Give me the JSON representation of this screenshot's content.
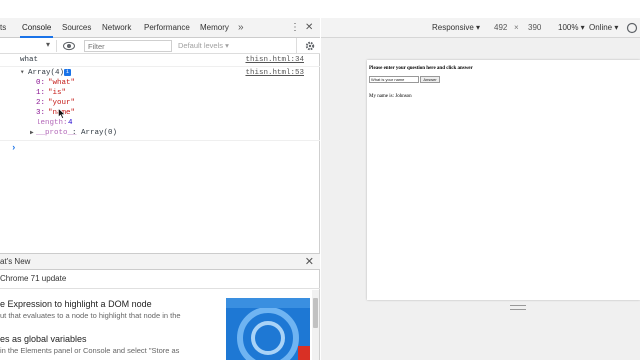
{
  "devtools": {
    "tabs": [
      {
        "label": "ts",
        "active": false
      },
      {
        "label": "Console",
        "active": true
      },
      {
        "label": "Sources",
        "active": false
      },
      {
        "label": "Network",
        "active": false
      },
      {
        "label": "Performance",
        "active": false
      },
      {
        "label": "Memory",
        "active": false
      }
    ],
    "more_tabs_icon": "»",
    "kebab_icon": "⋮",
    "close_icon": "✕",
    "filter": {
      "placeholder": "Filter",
      "levels_label": "Default levels ▾"
    },
    "console_lines": {
      "line1": {
        "text": "what",
        "source": "thisn.html:34"
      },
      "line2": {
        "array_label": "Array(4)",
        "info_badge": "i",
        "source": "thisn.html:53"
      },
      "items": [
        {
          "key": "0:",
          "value": "\"what\""
        },
        {
          "key": "1:",
          "value": "\"is\""
        },
        {
          "key": "2:",
          "value": "\"your\""
        },
        {
          "key": "3:",
          "value": "\"name\""
        }
      ],
      "length": {
        "key": "length:",
        "value": "4"
      },
      "proto": {
        "key": "__proto__",
        "value": ": Array(0)"
      },
      "prompt": "›"
    },
    "drawer": {
      "title": "at's New",
      "close_icon": "✕",
      "update_text": "Chrome 71 update",
      "features": [
        {
          "title": "e Expression to highlight a DOM node",
          "desc": "ut that evaluates to a node to highlight that node in the"
        },
        {
          "title": "es as global variables",
          "desc": "in the Elements panel or Console and select \"Store as"
        }
      ]
    }
  },
  "device_toolbar": {
    "mode": "Responsive ▾",
    "width": "492",
    "times": "×",
    "height": "390",
    "zoom": "100% ▾",
    "network": "Online ▾"
  },
  "page": {
    "heading": "Please enter your question here and click answer",
    "input_value": "What is your name",
    "button_label": "Answer",
    "answer_text": "My name is: Johnson"
  },
  "colors": {
    "accent": "#1a73e8",
    "tabbar_bg": "#f3f3f3",
    "string": "#c41a16",
    "key": "#881391",
    "number": "#1c00cf",
    "video_blue": "#1e78d4"
  }
}
